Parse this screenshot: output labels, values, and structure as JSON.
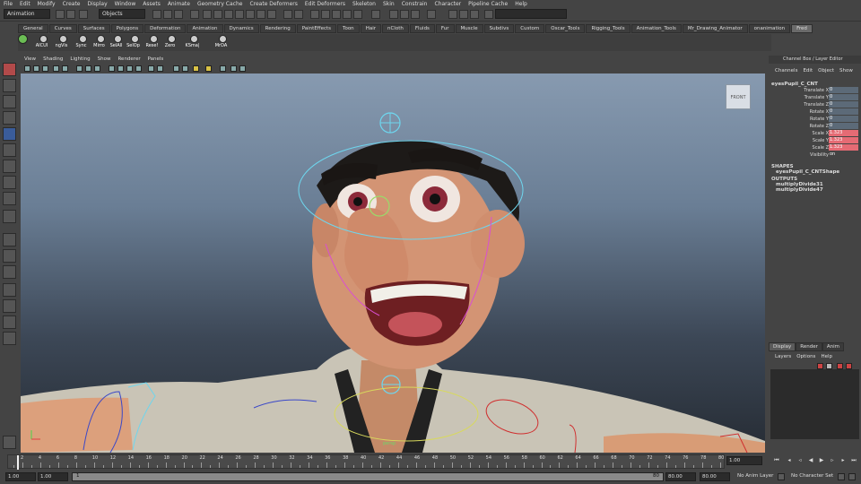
{
  "menubar": [
    "File",
    "Edit",
    "Modify",
    "Create",
    "Display",
    "Window",
    "Assets",
    "Animate",
    "Geometry Cache",
    "Create Deformers",
    "Edit Deformers",
    "Skeleton",
    "Skin",
    "Constrain",
    "Character",
    "Pipeline Cache",
    "Help"
  ],
  "status": {
    "mode": "Animation",
    "selection_mode": "Objects"
  },
  "shelf_tabs": [
    "General",
    "Curves",
    "Surfaces",
    "Polygons",
    "Deformation",
    "Animation",
    "Dynamics",
    "Rendering",
    "PaintEffects",
    "Toon",
    "Hair",
    "nCloth",
    "Fluids",
    "Fur",
    "Muscle",
    "Subdivs",
    "Custom",
    "Oscar_Tools",
    "Rigging_Tools",
    "Animation_Tools",
    "Mr_Drawing_Animator",
    "onanimation",
    "Fred"
  ],
  "shelf_active": "Fred",
  "shelf_buttons": [
    "AICUI",
    "ngVis",
    "Sync",
    "Mirro",
    "SelAll",
    "SelOp",
    "Rese!",
    "Zero",
    "KSma|",
    "MrDA"
  ],
  "panel_menu": [
    "View",
    "Shading",
    "Lighting",
    "Show",
    "Renderer",
    "Panels"
  ],
  "viewport": {
    "view_cube_label": "FRONT",
    "control_label": "persp"
  },
  "channel_box": {
    "title": "Channel Box / Layer Editor",
    "menu": [
      "Channels",
      "Edit",
      "Object",
      "Show"
    ],
    "object": "eyesPupil_C_CNT",
    "attributes": [
      {
        "name": "Translate X",
        "value": "0",
        "highlight": false
      },
      {
        "name": "Translate Y",
        "value": "0",
        "highlight": false
      },
      {
        "name": "Translate Z",
        "value": "0",
        "highlight": false
      },
      {
        "name": "Rotate X",
        "value": "0",
        "highlight": false
      },
      {
        "name": "Rotate Y",
        "value": "0",
        "highlight": false
      },
      {
        "name": "Rotate Z",
        "value": "0",
        "highlight": false
      },
      {
        "name": "Scale X",
        "value": "1.323",
        "highlight": true
      },
      {
        "name": "Scale Y",
        "value": "1.323",
        "highlight": true
      },
      {
        "name": "Scale Z",
        "value": "1.323",
        "highlight": true
      },
      {
        "name": "Visibility",
        "value": "on",
        "highlight": false
      }
    ],
    "shapes_label": "SHAPES",
    "shape": "eyesPupil_C_CNTShape",
    "outputs_label": "OUTPUTS",
    "outputs": [
      "multiplyDivide31",
      "multiplyDivide47"
    ]
  },
  "layer_editor": {
    "tabs": [
      "Display",
      "Render",
      "Anim"
    ],
    "menu": [
      "Layers",
      "Options",
      "Help"
    ]
  },
  "timeline": {
    "ticks": [
      "2",
      "4",
      "6",
      "8",
      "10",
      "12",
      "14",
      "16",
      "18",
      "20",
      "22",
      "24",
      "26",
      "28",
      "30",
      "32",
      "34",
      "36",
      "38",
      "40",
      "42",
      "44",
      "46",
      "48",
      "50",
      "52",
      "54",
      "56",
      "58",
      "60",
      "62",
      "64",
      "66",
      "68",
      "70",
      "72",
      "74",
      "76",
      "78",
      "80"
    ],
    "current_frame": "1.00"
  },
  "range": {
    "start": "1.00",
    "playback_start": "1.00",
    "range_start_label": "1",
    "range_end_label": "80",
    "playback_end": "80.00",
    "end": "80.00",
    "anim_layer": "No Anim Layer",
    "character_set": "No Character Set"
  }
}
